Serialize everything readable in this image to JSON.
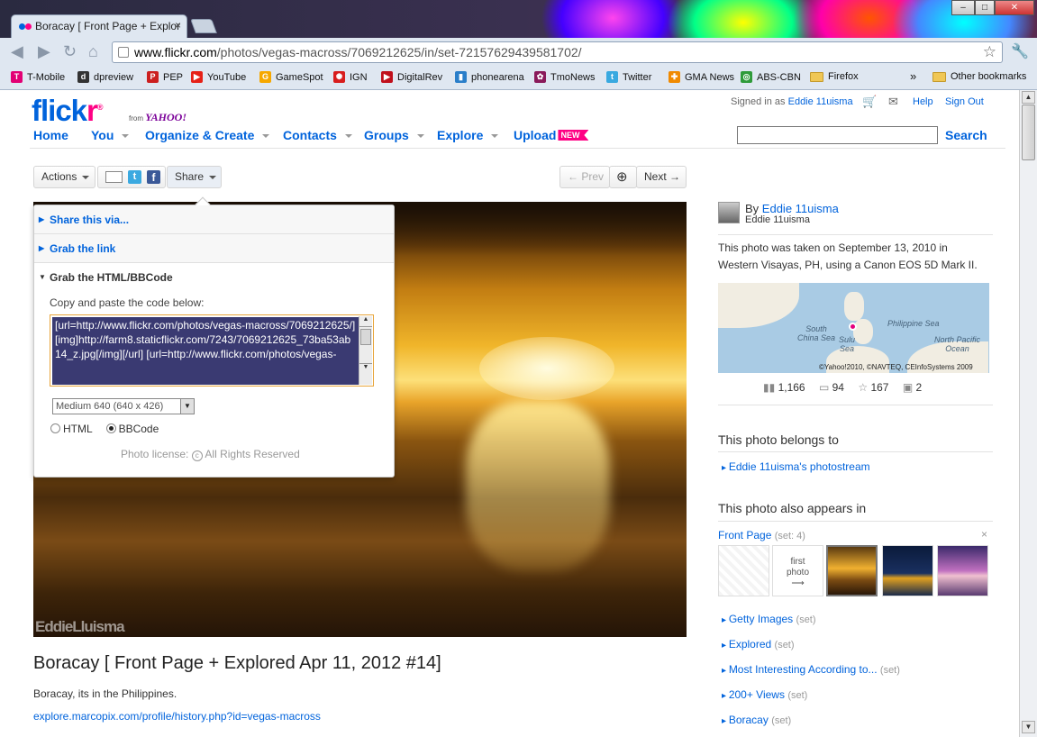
{
  "browser": {
    "tab_title": "Boracay [ Front Page + Explor",
    "tab_close": "×",
    "window_buttons": [
      "–",
      "□",
      "✕"
    ],
    "url_domain": "www.flickr.com",
    "url_path": "/photos/vegas-macross/7069212625/in/set-72157629439581702/",
    "bookmarks": [
      {
        "label": "T-Mobile",
        "color": "#e20074",
        "glyph": "T"
      },
      {
        "label": "dpreview",
        "color": "#333333",
        "glyph": "d"
      },
      {
        "label": "PEP",
        "color": "#cc1f1f",
        "glyph": "P"
      },
      {
        "label": "YouTube",
        "color": "#e62117",
        "glyph": "▶"
      },
      {
        "label": "GameSpot",
        "color": "#f6a800",
        "glyph": "G"
      },
      {
        "label": "IGN",
        "color": "#d81d1d",
        "glyph": "✺"
      },
      {
        "label": "DigitalRev",
        "color": "#c0101c",
        "glyph": "▶"
      },
      {
        "label": "phonearena",
        "color": "#2a7ec9",
        "glyph": "▮"
      },
      {
        "label": "TmoNews",
        "color": "#8a1a5a",
        "glyph": "✿"
      },
      {
        "label": "Twitter",
        "color": "#39a9e0",
        "glyph": "t"
      },
      {
        "label": "GMA News",
        "color": "#f08a00",
        "glyph": "✚"
      },
      {
        "label": "ABS-CBN",
        "color": "#2f9b3a",
        "glyph": "◎"
      },
      {
        "label": "Firefox",
        "folder": true
      }
    ],
    "bookmarks_more": "»",
    "other_bookmarks": "Other bookmarks"
  },
  "flickr": {
    "logo_a": "flick",
    "logo_b": "r",
    "logo_reg": "®",
    "from": "from",
    "yahoo": "YAHOO!",
    "signed_in_as": "Signed in as",
    "user": "Eddie 11uisma",
    "help": "Help",
    "sign_out": "Sign Out",
    "nav": [
      "Home",
      "You",
      "Organize & Create",
      "Contacts",
      "Groups",
      "Explore",
      "Upload"
    ],
    "new_badge": "NEW",
    "search_label": "Search"
  },
  "toolbar": {
    "actions": "Actions",
    "share": "Share",
    "prev": "← Prev",
    "next": "Next →",
    "zoom": "⊕"
  },
  "share_popup": {
    "share_via": "Share this via...",
    "grab_link": "Grab the link",
    "grab_html": "Grab the HTML/BBCode",
    "copy_instruction": "Copy and paste the code below:",
    "code": "[url=http://www.flickr.com/photos/vegas-macross/7069212625/][img]http://farm8.staticflickr.com/7243/7069212625_73ba53ab14_z.jpg[/img][/url] [url=http://www.flickr.com/photos/vegas-",
    "size_option": "Medium 640 (640 x 426)",
    "opt_html": "HTML",
    "opt_bbcode": "BBCode",
    "license_label": "Photo license:",
    "license_value": "All Rights Reserved"
  },
  "photo": {
    "watermark": "EddieLluisma",
    "title": "Boracay [ Front Page + Explored Apr 11, 2012 #14]",
    "description": "Boracay, its in the Philippines.",
    "link": "explore.marcopix.com/profile/history.php?id=vegas-macross"
  },
  "sidebar": {
    "by": "By",
    "owner": "Eddie 11uisma",
    "owner_sub": "Eddie 11uisma",
    "taken_line1": "This photo was taken on September 13, 2010 in",
    "taken_line2": "Western Visayas, PH, using a Canon EOS 5D Mark II.",
    "map_labels": {
      "south_china": "South",
      "south_china2": "China Sea",
      "sulu": "Sulu",
      "sulu2": "Sea",
      "philippine": "Philippine Sea",
      "north_pacific": "North Pacific",
      "north_pacific2": "Ocean",
      "copyright": "©Yahoo!2010, ©NAVTEQ, CEInfoSystems 2009"
    },
    "stats": {
      "views": "1,166",
      "comments": "94",
      "faves": "167",
      "sets": "2"
    },
    "belongs_to": "This photo belongs to",
    "photostream": "Eddie 11uisma's photostream",
    "also_appears": "This photo also appears in",
    "front_page": "Front Page",
    "front_page_meta": "(set: 4)",
    "first_photo": "first",
    "first_photo2": "photo",
    "first_photo_arrow": "⟶",
    "close": "×",
    "sets": [
      {
        "name": "Getty Images",
        "meta": "(set)"
      },
      {
        "name": "Explored",
        "meta": "(set)"
      },
      {
        "name": "Most Interesting According to...",
        "meta": "(set)"
      },
      {
        "name": "200+ Views",
        "meta": "(set)"
      },
      {
        "name": "Boracay",
        "meta": "(set)"
      }
    ]
  }
}
